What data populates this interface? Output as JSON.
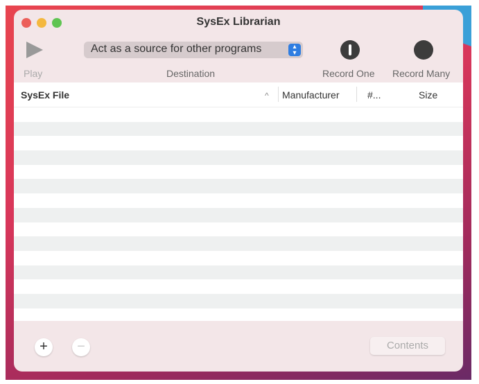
{
  "window": {
    "title": "SysEx Librarian"
  },
  "toolbar": {
    "play_label": "Play",
    "destination_value": "Act as a source for other programs",
    "destination_label": "Destination",
    "record_one_label": "Record One",
    "record_many_label": "Record Many"
  },
  "table": {
    "columns": [
      "SysEx File",
      "Manufacturer",
      "#...",
      "Size"
    ],
    "sort_indicator": "^",
    "rows": []
  },
  "footer": {
    "add": "+",
    "remove": "−",
    "contents_label": "Contents"
  },
  "colors": {
    "accent": "#2f7de1",
    "close": "#ec5f5a",
    "minimize": "#f4b83f",
    "zoom": "#5fc451"
  }
}
